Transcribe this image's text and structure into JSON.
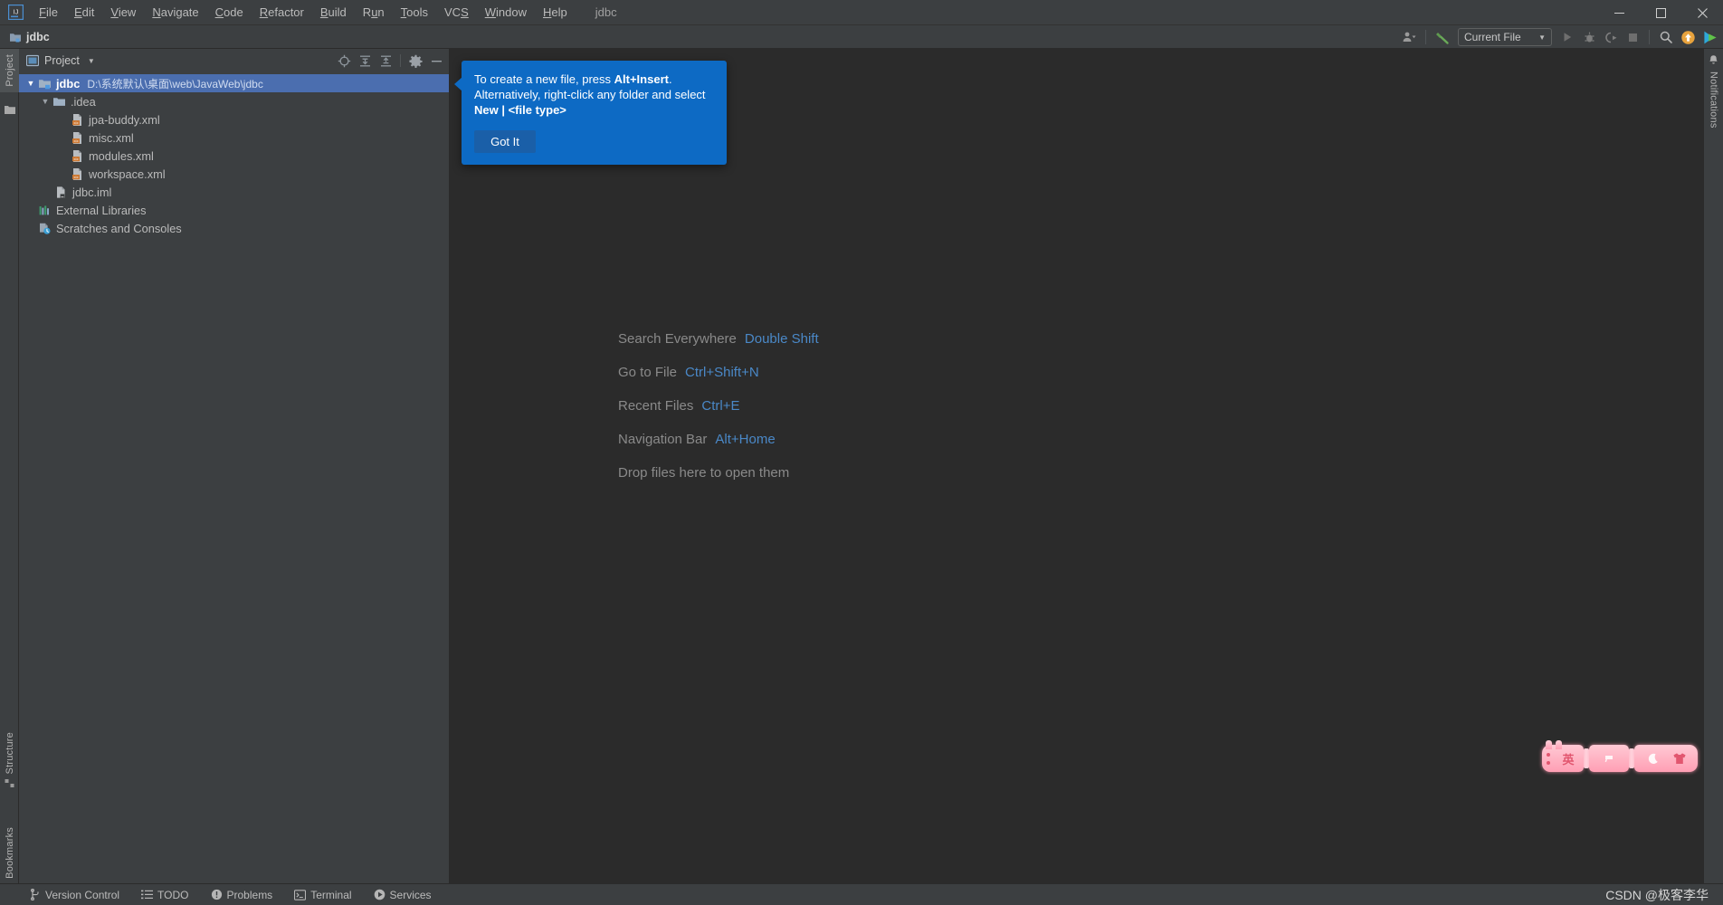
{
  "window": {
    "project_title": "jdbc",
    "minimize_label": "—",
    "maximize_label": "☐",
    "close_label": "✕"
  },
  "menu": {
    "items": [
      {
        "label": "File",
        "mnemonic": "F"
      },
      {
        "label": "Edit",
        "mnemonic": "E"
      },
      {
        "label": "View",
        "mnemonic": "V"
      },
      {
        "label": "Navigate",
        "mnemonic": "N"
      },
      {
        "label": "Code",
        "mnemonic": "C"
      },
      {
        "label": "Refactor",
        "mnemonic": "R"
      },
      {
        "label": "Build",
        "mnemonic": "B"
      },
      {
        "label": "Run",
        "mnemonic": "u"
      },
      {
        "label": "Tools",
        "mnemonic": "T"
      },
      {
        "label": "VCS",
        "mnemonic": "S"
      },
      {
        "label": "Window",
        "mnemonic": "W"
      },
      {
        "label": "Help",
        "mnemonic": "H"
      }
    ]
  },
  "navbar": {
    "breadcrumb": "jdbc",
    "run_configuration": "Current File",
    "caret": "▾"
  },
  "project_panel": {
    "title": "Project",
    "caret": "▾",
    "tree": [
      {
        "label": "jdbc",
        "path": "D:\\系统默认\\桌面\\web\\JavaWeb\\jdbc",
        "icon": "module-folder-icon",
        "indent": 0,
        "arrow": "expanded",
        "selected": true,
        "bold": true
      },
      {
        "label": ".idea",
        "path": "",
        "icon": "folder-icon",
        "indent": 1,
        "arrow": "expanded",
        "selected": false,
        "bold": false
      },
      {
        "label": "jpa-buddy.xml",
        "path": "",
        "icon": "xml-file-icon",
        "indent": 2,
        "arrow": "none",
        "selected": false,
        "bold": false
      },
      {
        "label": "misc.xml",
        "path": "",
        "icon": "xml-file-icon",
        "indent": 2,
        "arrow": "none",
        "selected": false,
        "bold": false
      },
      {
        "label": "modules.xml",
        "path": "",
        "icon": "xml-file-icon",
        "indent": 2,
        "arrow": "none",
        "selected": false,
        "bold": false
      },
      {
        "label": "workspace.xml",
        "path": "",
        "icon": "xml-file-icon",
        "indent": 2,
        "arrow": "none",
        "selected": false,
        "bold": false
      },
      {
        "label": "jdbc.iml",
        "path": "",
        "icon": "iml-file-icon",
        "indent": 1,
        "arrow": "none",
        "selected": false,
        "bold": false
      },
      {
        "label": "External Libraries",
        "path": "",
        "icon": "libraries-icon",
        "indent": 0,
        "arrow": "none",
        "selected": false,
        "bold": false
      },
      {
        "label": "Scratches and Consoles",
        "path": "",
        "icon": "scratches-icon",
        "indent": 0,
        "arrow": "none",
        "selected": false,
        "bold": false
      }
    ]
  },
  "balloon": {
    "line1_pre": "To create a new file, press ",
    "line1_bold": "Alt+Insert",
    "line1_post": ".",
    "line2": "Alternatively, right-click any folder and select",
    "line3_bold": "New | <file type>",
    "button_label": "Got It",
    "background": "#0d6ac4"
  },
  "editor_hints": [
    {
      "action": "Search Everywhere",
      "shortcut": "Double Shift"
    },
    {
      "action": "Go to File",
      "shortcut": "Ctrl+Shift+N"
    },
    {
      "action": "Recent Files",
      "shortcut": "Ctrl+E"
    },
    {
      "action": "Navigation Bar",
      "shortcut": "Alt+Home"
    },
    {
      "action": "Drop files here to open them",
      "shortcut": ""
    }
  ],
  "left_stripe": {
    "top_items": [
      {
        "label": "Project",
        "active": true
      }
    ],
    "bottom_items": [
      {
        "label": "Structure",
        "active": false
      },
      {
        "label": "Bookmarks",
        "active": false
      }
    ]
  },
  "right_stripe": {
    "items": [
      {
        "label": "Notifications",
        "active": false
      }
    ]
  },
  "statusbar": {
    "items": [
      {
        "label": "Version Control",
        "icon": "branch-icon"
      },
      {
        "label": "TODO",
        "icon": "list-icon"
      },
      {
        "label": "Problems",
        "icon": "warning-icon"
      },
      {
        "label": "Terminal",
        "icon": "terminal-icon"
      },
      {
        "label": "Services",
        "icon": "services-icon"
      }
    ],
    "watermark": "CSDN @极客李华"
  },
  "ime_bar": {
    "mode_label": "英",
    "segments": [
      "cat-face",
      "comma-key",
      "moon-key",
      "shirt-key"
    ]
  },
  "colors": {
    "accent_blue": "#4b6eaf",
    "link_blue": "#4a88c7",
    "balloon_blue": "#0d6ac4",
    "panel_bg": "#3c3f41",
    "editor_bg": "#2b2b2b",
    "text": "#bbbbbb"
  }
}
